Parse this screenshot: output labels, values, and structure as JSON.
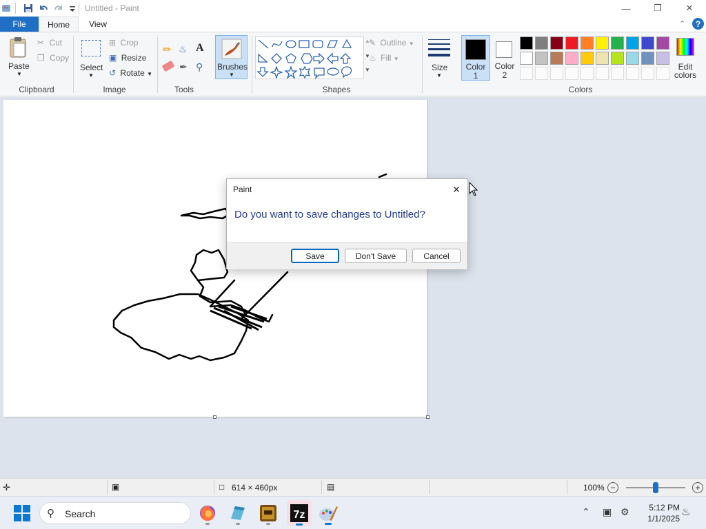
{
  "window": {
    "title": "Untitled - Paint"
  },
  "tabs": {
    "file": "File",
    "home": "Home",
    "view": "View"
  },
  "ribbon": {
    "clipboard": {
      "paste": "Paste",
      "cut": "Cut",
      "copy": "Copy",
      "label": "Clipboard"
    },
    "image": {
      "select": "Select",
      "crop": "Crop",
      "resize": "Resize",
      "rotate": "Rotate",
      "label": "Image"
    },
    "tools": {
      "label": "Tools"
    },
    "brushes": {
      "label": "Brushes"
    },
    "shapes": {
      "outline": "Outline",
      "fill": "Fill",
      "label": "Shapes"
    },
    "size": {
      "label": "Size"
    },
    "colors": {
      "color1": "Color 1",
      "color2": "Color 2",
      "edit": "Edit colors",
      "label": "Colors",
      "color1_value": "#000000",
      "color2_value": "#ffffff",
      "palette_row1": [
        "#000000",
        "#7f7f7f",
        "#880015",
        "#ed1c24",
        "#ff7f27",
        "#fff200",
        "#22b14c",
        "#00a2e8",
        "#3f48cc",
        "#a349a4"
      ],
      "palette_row2": [
        "#ffffff",
        "#c3c3c3",
        "#b97a57",
        "#ffaec9",
        "#ffc90e",
        "#efe4b0",
        "#b5e61d",
        "#99d9ea",
        "#7092be",
        "#c8bfe7"
      ]
    }
  },
  "status": {
    "canvas_size": "614 × 460px",
    "zoom": "100%",
    "zoom_fraction": 0.5
  },
  "dialog": {
    "title": "Paint",
    "message": "Do you want to save changes to Untitled?",
    "save": "Save",
    "dont_save": "Don't Save",
    "cancel": "Cancel"
  },
  "taskbar": {
    "search": "Search",
    "time": "5:12 PM",
    "date": "1/1/2025"
  }
}
